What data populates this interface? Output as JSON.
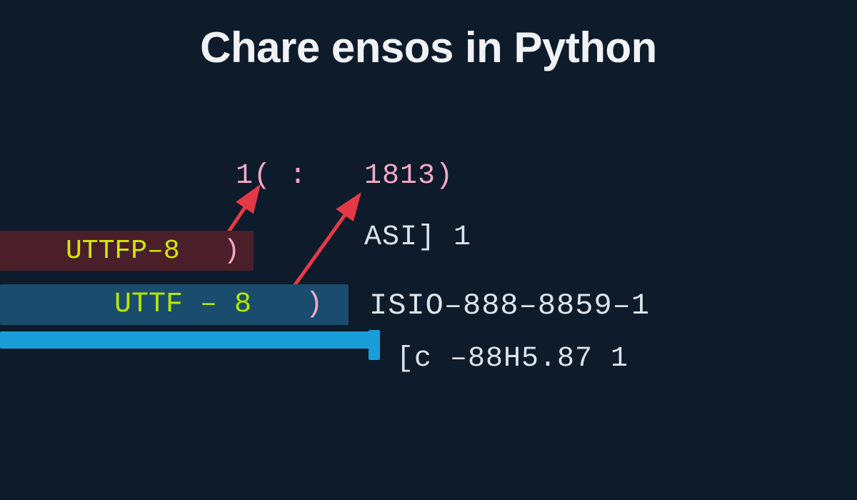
{
  "title": "Chare ensos in Python",
  "topline": {
    "left": "1( :",
    "right": "1813)"
  },
  "bars": {
    "bar1": {
      "text": "UTTFP–8",
      "paren": ")"
    },
    "bar2": {
      "text": "UTTF – 8",
      "paren": ")"
    }
  },
  "labels": {
    "asi": "ASI] 1",
    "isio": "ISIO–888–8859–1",
    "c88": "[c –88H5.87 1"
  },
  "colors": {
    "bg": "#0d1b2a",
    "title": "#f0f2f5",
    "pink": "#f4a8c8",
    "yellowgreen": "#d4e800",
    "limegreen": "#b4e800",
    "offwhite": "#dde3ea",
    "darkred": "#4a1f2a",
    "tealblue": "#1a4d6d",
    "brightblue": "#1a9ed9",
    "arrow": "#e63946"
  }
}
